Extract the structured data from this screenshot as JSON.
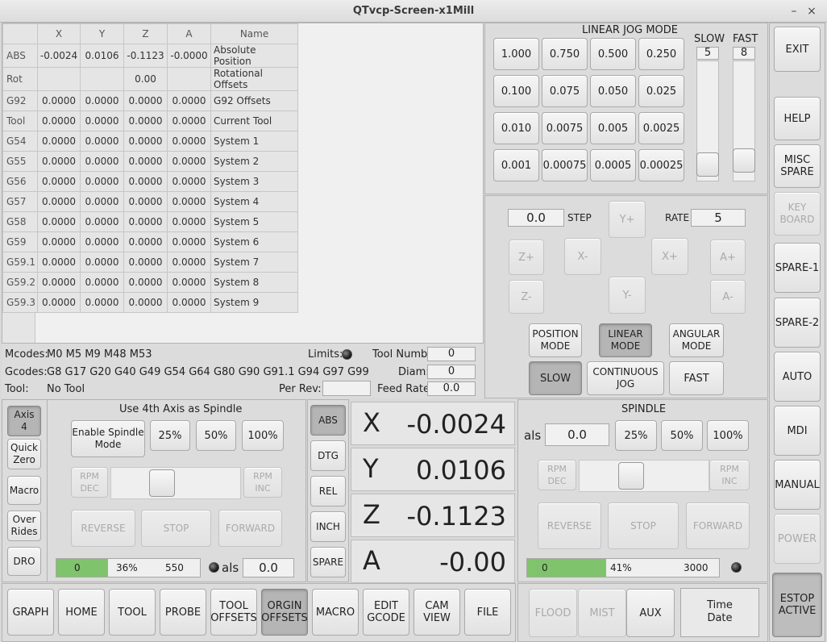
{
  "window": {
    "title": "QTvcp-Screen-x1Mill",
    "minimize": "–",
    "close": "×"
  },
  "offsets": {
    "headers": [
      "",
      "X",
      "Y",
      "Z",
      "A",
      "Name"
    ],
    "rows": [
      [
        "ABS",
        "-0.0024",
        "0.0106",
        "-0.1123",
        "-0.0000",
        "Absolute Position"
      ],
      [
        "Rot",
        "",
        "",
        "0.00",
        "",
        "Rotational Offsets"
      ],
      [
        "G92",
        "0.0000",
        "0.0000",
        "0.0000",
        "0.0000",
        "G92 Offsets"
      ],
      [
        "Tool",
        "0.0000",
        "0.0000",
        "0.0000",
        "0.0000",
        "Current Tool"
      ],
      [
        "G54",
        "0.0000",
        "0.0000",
        "0.0000",
        "0.0000",
        "System 1"
      ],
      [
        "G55",
        "0.0000",
        "0.0000",
        "0.0000",
        "0.0000",
        "System 2"
      ],
      [
        "G56",
        "0.0000",
        "0.0000",
        "0.0000",
        "0.0000",
        "System 3"
      ],
      [
        "G57",
        "0.0000",
        "0.0000",
        "0.0000",
        "0.0000",
        "System 4"
      ],
      [
        "G58",
        "0.0000",
        "0.0000",
        "0.0000",
        "0.0000",
        "System 5"
      ],
      [
        "G59",
        "0.0000",
        "0.0000",
        "0.0000",
        "0.0000",
        "System 6"
      ],
      [
        "G59.1",
        "0.0000",
        "0.0000",
        "0.0000",
        "0.0000",
        "System 7"
      ],
      [
        "G59.2",
        "0.0000",
        "0.0000",
        "0.0000",
        "0.0000",
        "System 8"
      ],
      [
        "G59.3",
        "0.0000",
        "0.0000",
        "0.0000",
        "0.0000",
        "System 9"
      ]
    ]
  },
  "status": {
    "mcodes_label": "Mcodes:",
    "mcodes": "M0 M5 M9 M48 M53",
    "gcodes_label": "Gcodes:",
    "gcodes": "G8 G17 G20 G40 G49 G54 G64 G80 G90 G91.1 G94 G97 G99",
    "tool_label": "Tool:",
    "tool": "No Tool",
    "limits_label": "Limits:",
    "tool_numb_label": "Tool Numb:",
    "tool_numb": "0",
    "diam_label": "Diam:",
    "diam": "0",
    "per_rev_label": "Per Rev:",
    "per_rev": "",
    "feed_rate_label": "Feed Rate:",
    "feed_rate": "0.0"
  },
  "jog": {
    "title": "LINEAR  JOG  MODE",
    "increments": [
      "1.000",
      "0.750",
      "0.500",
      "0.250",
      "0.100",
      "0.075",
      "0.050",
      "0.025",
      "0.010",
      "0.0075",
      "0.005",
      "0.0025",
      "0.001",
      "0.00075",
      "0.0005",
      "0.00025"
    ],
    "slow_label": "SLOW",
    "slow_value": "5",
    "fast_label": "FAST",
    "fast_value": "8",
    "step_value": "0.0",
    "step_label": "STEP",
    "rate_label": "RATE",
    "rate_value": "5",
    "y_plus": "Y+",
    "y_minus": "Y-",
    "x_minus": "X-",
    "x_plus": "X+",
    "z_plus": "Z+",
    "z_minus": "Z-",
    "a_plus": "A+",
    "a_minus": "A-",
    "position_mode": "POSITION\nMODE",
    "linear_mode": "LINEAR\nMODE",
    "angular_mode": "ANGULAR\nMODE",
    "slow": "SLOW",
    "continuous": "CONTINUOUS\nJOG",
    "fast": "FAST"
  },
  "side": {
    "exit": "EXIT",
    "help": "HELP",
    "misc_spare": "MISC\nSPARE",
    "keyboard": "KEY\nBOARD",
    "spare1": "SPARE-1",
    "spare2": "SPARE-2",
    "auto": "AUTO",
    "mdi": "MDI",
    "manual": "MANUAL",
    "power": "POWER",
    "estop": "ESTOP\nACTIVE"
  },
  "axis4": {
    "axis4": "Axis\n4",
    "quick_zero": "Quick\nZero",
    "macro": "Macro",
    "over_rides": "Over\nRides",
    "dro": "DRO",
    "title": "Use 4th Axis as Spindle",
    "enable": "Enable Spindle\nMode",
    "p25": "25%",
    "p50": "50%",
    "p100": "100%",
    "rpm_dec": "RPM\nDEC",
    "rpm_inc": "RPM\nINC",
    "reverse": "REVERSE",
    "stop": "STOP",
    "forward": "FORWARD",
    "bar_min": "0",
    "bar_pct": "36%",
    "bar_max": "550",
    "bar_fraction": 0.36,
    "als_label": "als",
    "als_value": "0.0"
  },
  "dro": {
    "abs": "ABS",
    "dtg": "DTG",
    "rel": "REL",
    "inch": "INCH",
    "spare": "SPARE",
    "axes": [
      {
        "name": "X",
        "value": "-0.0024"
      },
      {
        "name": "Y",
        "value": "0.0106"
      },
      {
        "name": "Z",
        "value": "-0.1123"
      },
      {
        "name": "A",
        "value": "-0.00"
      }
    ]
  },
  "spindle": {
    "title": "SPINDLE",
    "als_label": "als",
    "als_value": "0.0",
    "p25": "25%",
    "p50": "50%",
    "p100": "100%",
    "rpm_dec": "RPM\nDEC",
    "rpm_inc": "RPM\nINC",
    "reverse": "REVERSE",
    "stop": "STOP",
    "forward": "FORWARD",
    "bar_min": "0",
    "bar_pct": "41%",
    "bar_max": "3000",
    "bar_fraction": 0.41
  },
  "bottom": {
    "tabs": [
      "GRAPH",
      "HOME",
      "TOOL",
      "PROBE",
      "TOOL\nOFFSETS",
      "ORGIN\nOFFSETS",
      "MACRO",
      "EDIT\nGCODE",
      "CAM\nVIEW",
      "FILE"
    ],
    "flood": "FLOOD",
    "mist": "MIST",
    "aux": "AUX",
    "time_date": "Time\nDate"
  }
}
